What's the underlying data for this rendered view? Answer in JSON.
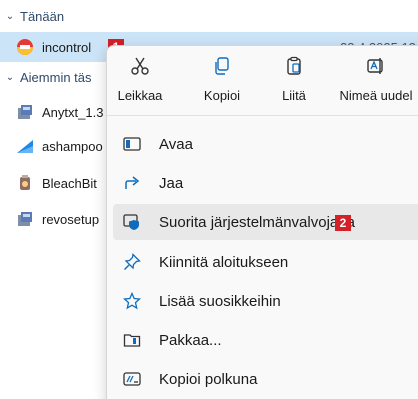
{
  "groups": {
    "today_label": "Tänään",
    "earlier_label": "Aiemmin täs"
  },
  "files": {
    "today": [
      {
        "name": "incontrol",
        "date": "23.4.2025 12",
        "icon": "incontrol-app-icon"
      }
    ],
    "earlier": [
      {
        "name": "Anytxt_1.3",
        "icon": "installer-icon"
      },
      {
        "name": "ashampoo",
        "icon": "ashampoo-icon"
      },
      {
        "name": "BleachBit",
        "icon": "bleachbit-icon"
      },
      {
        "name": "revosetup",
        "icon": "installer-icon"
      }
    ]
  },
  "badges": {
    "file": "1",
    "run_as_admin": "2"
  },
  "context_menu": {
    "toolbar": [
      {
        "id": "cut",
        "label": "Leikkaa",
        "icon": "scissors-icon"
      },
      {
        "id": "copy",
        "label": "Kopioi",
        "icon": "copy-icon"
      },
      {
        "id": "paste",
        "label": "Liitä",
        "icon": "paste-icon"
      },
      {
        "id": "rename",
        "label": "Nimeä uudel",
        "icon": "rename-icon"
      }
    ],
    "items": [
      {
        "id": "open",
        "label": "Avaa",
        "icon": "window-icon"
      },
      {
        "id": "share",
        "label": "Jaa",
        "icon": "share-icon"
      },
      {
        "id": "run-as-admin",
        "label": "Suorita järjestelmänvalvojana",
        "icon": "shield-icon",
        "highlighted": true
      },
      {
        "id": "pin-start",
        "label": "Kiinnitä aloitukseen",
        "icon": "pin-icon"
      },
      {
        "id": "add-favorites",
        "label": "Lisää suosikkeihin",
        "icon": "star-icon"
      },
      {
        "id": "compress",
        "label": "Pakkaa...",
        "icon": "zip-icon"
      },
      {
        "id": "copy-path",
        "label": "Kopioi polkuna",
        "icon": "path-icon"
      }
    ]
  },
  "colors": {
    "accent": "#0f6cbd",
    "selection": "#cce4f7",
    "badge": "#d42027",
    "menu_bg": "#f9f9f9"
  }
}
